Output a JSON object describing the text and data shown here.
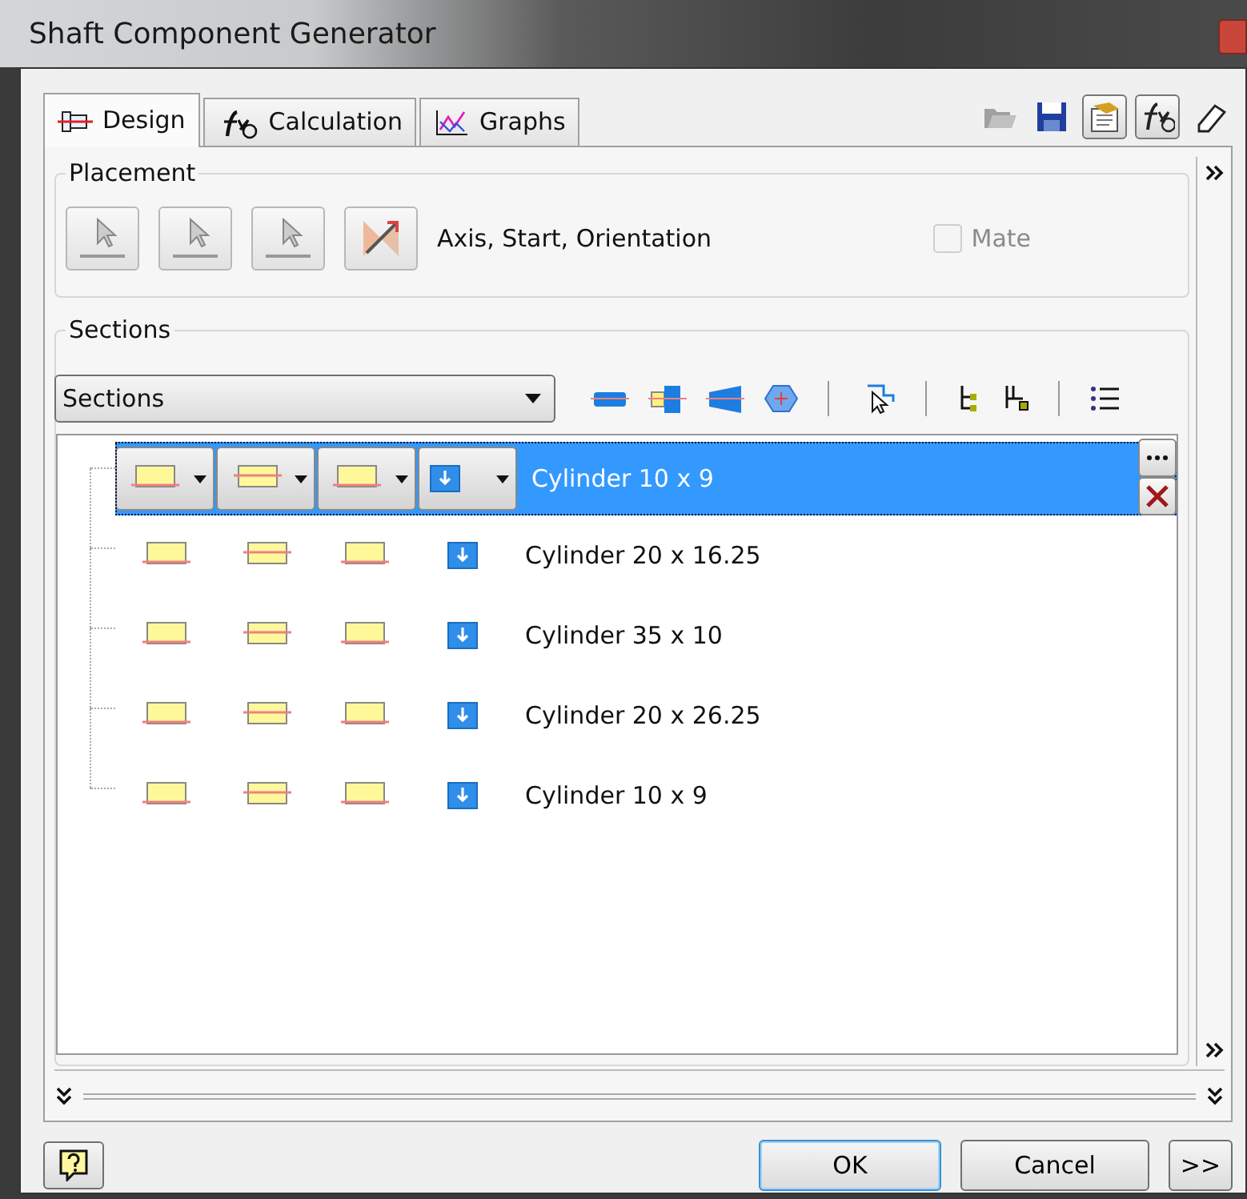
{
  "window": {
    "title": "Shaft Component Generator"
  },
  "tabs": [
    {
      "label": "Design",
      "selected": true
    },
    {
      "label": "Calculation",
      "selected": false
    },
    {
      "label": "Graphs",
      "selected": false
    }
  ],
  "toolbar_buttons": [
    {
      "pressed": false
    },
    {
      "pressed": false
    },
    {
      "pressed": true
    },
    {
      "pressed": true
    },
    {
      "pressed": false
    }
  ],
  "placement": {
    "title": "Placement",
    "description": "Axis, Start, Orientation",
    "mate": {
      "label": "Mate",
      "checked": false,
      "disabled": true
    }
  },
  "sections": {
    "title": "Sections",
    "dropdown": "Sections",
    "rows": [
      {
        "label": "Cylinder 10 x 9",
        "selected": true
      },
      {
        "label": "Cylinder 20 x 16.25",
        "selected": false
      },
      {
        "label": "Cylinder 35 x 10",
        "selected": false
      },
      {
        "label": "Cylinder 20 x 26.25",
        "selected": false
      },
      {
        "label": "Cylinder 10 x 9",
        "selected": false
      }
    ]
  },
  "buttons": [
    {
      "label": "OK",
      "kind": "default"
    },
    {
      "label": "Cancel",
      "kind": "normal"
    },
    {
      "label": ">>",
      "kind": "normal"
    }
  ]
}
